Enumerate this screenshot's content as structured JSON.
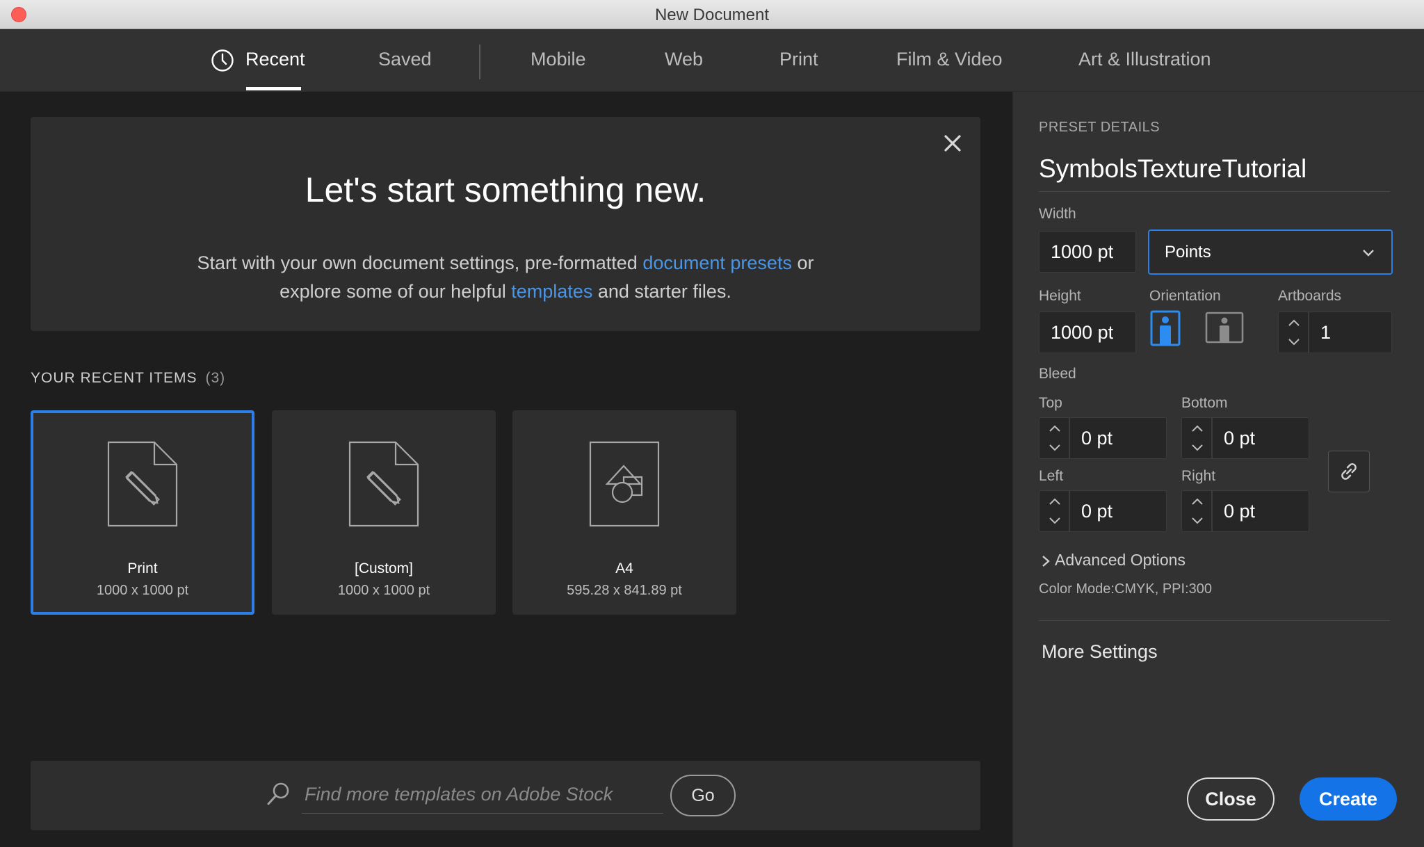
{
  "window": {
    "title": "New Document"
  },
  "tabs": [
    {
      "label": "Recent",
      "active": true,
      "icon": "clock-icon"
    },
    {
      "label": "Saved"
    },
    {
      "label": "Mobile"
    },
    {
      "label": "Web"
    },
    {
      "label": "Print"
    },
    {
      "label": "Film & Video"
    },
    {
      "label": "Art & Illustration"
    }
  ],
  "hero": {
    "title": "Let's start something new.",
    "line1_pre": "Start with your own document settings, pre-formatted ",
    "line1_link": "document presets",
    "line1_post": " or",
    "line2_pre": "explore some of our helpful ",
    "line2_link": "templates",
    "line2_post": " and starter files."
  },
  "recent": {
    "label": "YOUR RECENT ITEMS",
    "count": "(3)",
    "items": [
      {
        "name": "Print",
        "size": "1000 x 1000 pt",
        "icon": "print-document-icon",
        "selected": true
      },
      {
        "name": "[Custom]",
        "size": "1000 x 1000 pt",
        "icon": "custom-document-icon"
      },
      {
        "name": "A4",
        "size": "595.28 x 841.89 pt",
        "icon": "shapes-document-icon"
      }
    ]
  },
  "search": {
    "placeholder": "Find more templates on Adobe Stock",
    "go_label": "Go"
  },
  "preset": {
    "section_label": "PRESET DETAILS",
    "name": "SymbolsTextureTutorial",
    "width_label": "Width",
    "width_value": "1000 pt",
    "units": "Points",
    "height_label": "Height",
    "height_value": "1000 pt",
    "orientation_label": "Orientation",
    "orientation": "portrait",
    "artboards_label": "Artboards",
    "artboards_value": "1",
    "bleed_label": "Bleed",
    "top_label": "Top",
    "top_value": "0 pt",
    "bottom_label": "Bottom",
    "bottom_value": "0 pt",
    "left_label": "Left",
    "left_value": "0 pt",
    "right_label": "Right",
    "right_value": "0 pt",
    "advanced_label": "Advanced Options",
    "color_mode": "Color Mode:CMYK, PPI:300",
    "more_settings": "More Settings",
    "close_label": "Close",
    "create_label": "Create"
  },
  "colors": {
    "accent": "#1473e6",
    "selected_border": "#2d7fe8",
    "link": "#4a95e6",
    "close_dot": "#fc5e57"
  }
}
